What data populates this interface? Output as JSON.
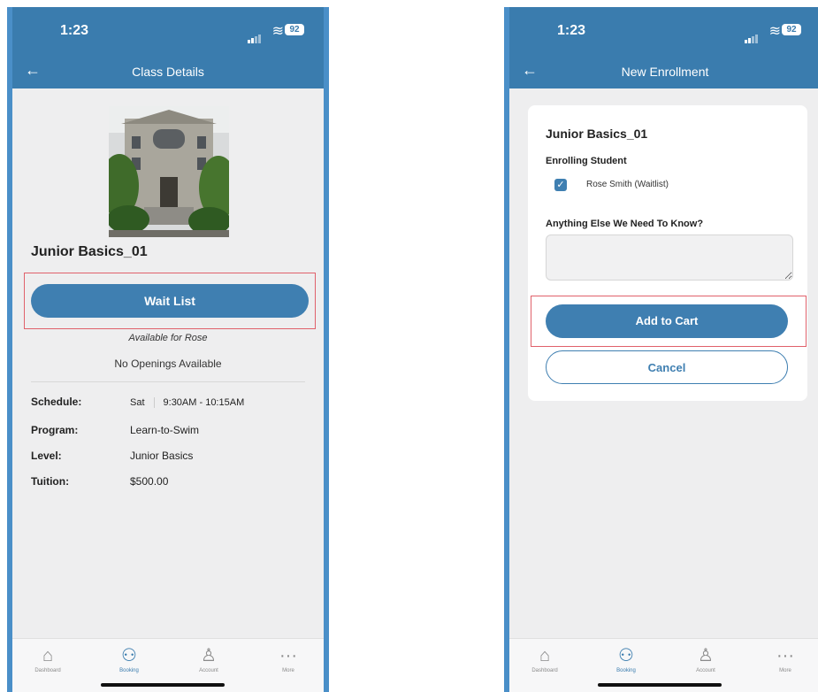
{
  "status_bar": {
    "time": "1:23",
    "battery": "92"
  },
  "left_screen": {
    "nav_title": "Class Details",
    "class_name": "Junior Basics_01",
    "wait_list_button": "Wait List",
    "availability_note": "Available for Rose",
    "openings_status": "No Openings Available",
    "details": {
      "schedule_label": "Schedule:",
      "schedule_day": "Sat",
      "schedule_time": "9:30AM - 10:15AM",
      "program_label": "Program:",
      "program_value": "Learn-to-Swim",
      "level_label": "Level:",
      "level_value": "Junior Basics",
      "tuition_label": "Tuition:",
      "tuition_value": "$500.00"
    }
  },
  "right_screen": {
    "nav_title": "New Enrollment",
    "class_name": "Junior Basics_01",
    "enrolling_label": "Enrolling Student",
    "student_option": "Rose Smith  (Waitlist)",
    "student_checked": true,
    "notes_question": "Anything Else We Need To Know?",
    "notes_value": "",
    "add_to_cart_button": "Add to Cart",
    "cancel_button": "Cancel"
  },
  "tab_bar": {
    "items": [
      {
        "label": "Dashboard",
        "icon": "home-icon"
      },
      {
        "label": "Booking",
        "icon": "people-icon",
        "active": true
      },
      {
        "label": "Account",
        "icon": "person-icon"
      },
      {
        "label": "More",
        "icon": "more-icon"
      }
    ]
  },
  "colors": {
    "brand": "#3a7cae",
    "button": "#3f7fb1",
    "highlight": "#e0616b",
    "frame": "#4a8fc8"
  }
}
